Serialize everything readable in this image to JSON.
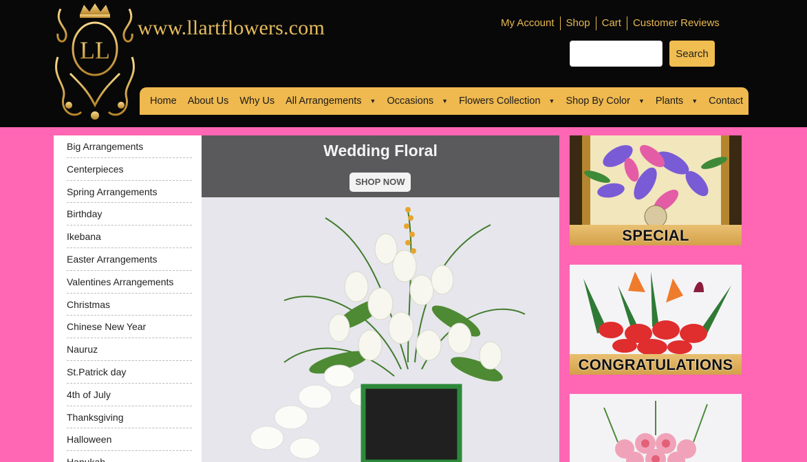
{
  "header": {
    "site_name": "www.llartflowers.com",
    "logo_text": "LL",
    "top_links": [
      "My Account",
      "Shop",
      "Cart",
      "Customer Reviews"
    ],
    "search": {
      "placeholder": "",
      "button_label": "Search"
    }
  },
  "nav": {
    "items": [
      {
        "label": "Home",
        "dropdown": false
      },
      {
        "label": "About Us",
        "dropdown": false
      },
      {
        "label": "Why Us",
        "dropdown": false
      },
      {
        "label": "All Arrangements",
        "dropdown": true
      },
      {
        "label": "Occasions",
        "dropdown": true
      },
      {
        "label": "Flowers Collection",
        "dropdown": true
      },
      {
        "label": "Shop By Color",
        "dropdown": true
      },
      {
        "label": "Plants",
        "dropdown": true
      },
      {
        "label": "Contact",
        "dropdown": false
      }
    ],
    "caret": "▼"
  },
  "sidebar": {
    "items": [
      "Big Arrangements",
      "Centerpieces",
      "Spring Arrangements",
      "Birthday",
      "Ikebana",
      "Easter Arrangements",
      "Valentines Arrangements",
      "Christmas",
      "Chinese New Year",
      "Nauruz",
      "St.Patrick day",
      "4th of July",
      "Thanksgiving",
      "Halloween",
      "Hanukah"
    ]
  },
  "banner": {
    "title": "Wedding Floral",
    "button_label": "SHOP NOW"
  },
  "promos": [
    {
      "label": "SPECIAL OCCASSIONS"
    },
    {
      "label": "CONGRATULATIONS"
    },
    {
      "label": ""
    }
  ],
  "colors": {
    "header_bg": "#080808",
    "gold": "#efb94f",
    "page_bg": "#ff66b3"
  }
}
